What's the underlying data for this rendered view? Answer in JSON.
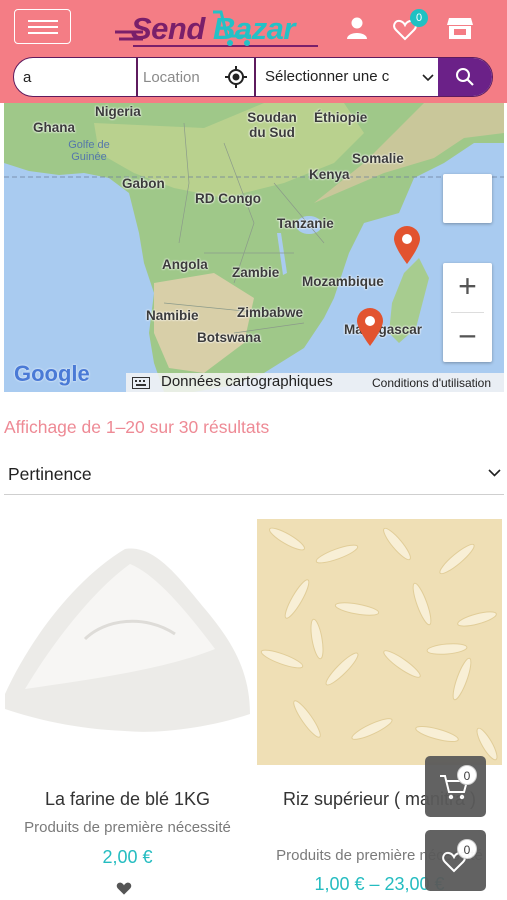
{
  "header": {
    "logo_send": "Send",
    "logo_bazar": "Bazar",
    "wishlist_count": "0"
  },
  "search": {
    "query_value": "a",
    "location_placeholder": "Location",
    "category_selected": "Sélectionner une c"
  },
  "map": {
    "labels": {
      "nigeria": "Nigeria",
      "ghana": "Ghana",
      "gulf": "Golfe de Guinée",
      "soudan": "Soudan du Sud",
      "ethiopie": "Éthiopie",
      "somalie": "Somalie",
      "gabon": "Gabon",
      "kenya": "Kenya",
      "rdcongo": "RD Congo",
      "tanzanie": "Tanzanie",
      "angola": "Angola",
      "zambie": "Zambie",
      "mozambique": "Mozambique",
      "namibie": "Namibie",
      "zimbabwe": "Zimbabwe",
      "botswana": "Botswana",
      "madagascar": "Madagascar"
    },
    "google_logo": "Google",
    "map_data_label": "Données cartographiques",
    "terms_label": "Conditions d'utilisation",
    "zoom_in": "+",
    "zoom_out": "−"
  },
  "results": {
    "count_text": "Affichage de 1–20 sur 30 résultats",
    "sort_selected": "Pertinence"
  },
  "products": [
    {
      "name": "La farine de blé 1KG",
      "category": "Produits de première nécessité",
      "price": "2,00 €"
    },
    {
      "name": "Riz supérieur ( manitra )",
      "category": "Produits de première nécessité",
      "price": "1,00 € – 23,00 €"
    }
  ],
  "floating": {
    "cart_count": "0",
    "wishlist_count": "0"
  },
  "colors": {
    "header_bg": "#f47d85",
    "brand_purple": "#6b2188",
    "accent_teal": "#24bcc0",
    "results_pink": "#ee8a95"
  }
}
